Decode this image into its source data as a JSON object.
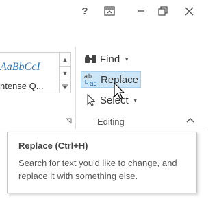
{
  "titlebar": {
    "help_label": "?",
    "restore_ribbon_icon": "ribbon-display-options-icon",
    "minimize_icon": "minimize-icon",
    "restore_icon": "restore-window-icon",
    "close_icon": "close-icon"
  },
  "styles": {
    "preview_text": "AaBbCcI",
    "name": "ntense Q...",
    "preview_color": "#2e74b5"
  },
  "editing": {
    "find_label": "Find",
    "replace_label": "Replace",
    "select_label": "Select",
    "group_label": "Editing",
    "highlight_color": "#cde6f7"
  },
  "tooltip": {
    "title": "Replace (Ctrl+H)",
    "description": "Search for text you'd like to change, and replace it with something else."
  }
}
